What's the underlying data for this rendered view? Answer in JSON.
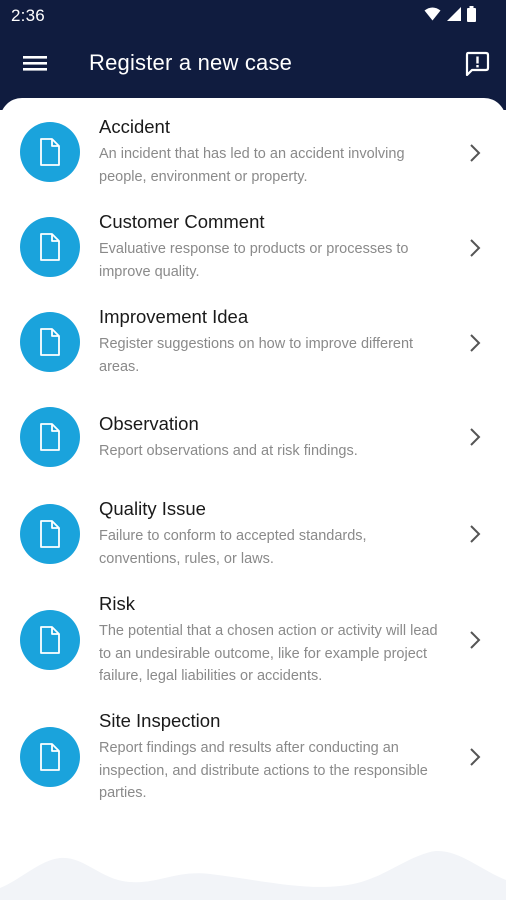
{
  "status_bar": {
    "time": "2:36"
  },
  "header": {
    "title": "Register a new case"
  },
  "colors": {
    "app_bar": "#101c3f",
    "icon_circle": "#1aa3dc"
  },
  "items": [
    {
      "title": "Accident",
      "description": "An incident that has led to an accident involving people, environment or property."
    },
    {
      "title": "Customer Comment",
      "description": "Evaluative response to products or processes to improve quality."
    },
    {
      "title": "Improvement Idea",
      "description": "Register suggestions on how to improve different areas."
    },
    {
      "title": "Observation",
      "description": "Report observations and at risk findings."
    },
    {
      "title": "Quality Issue",
      "description": "Failure to conform to accepted standards, conventions, rules, or laws."
    },
    {
      "title": "Risk",
      "description": "The potential that a chosen action or activity will lead to an undesirable outcome, like for example project failure, legal liabilities or accidents."
    },
    {
      "title": "Site Inspection",
      "description": "Report findings and results after conducting an inspection, and distribute actions to the responsible parties."
    }
  ]
}
